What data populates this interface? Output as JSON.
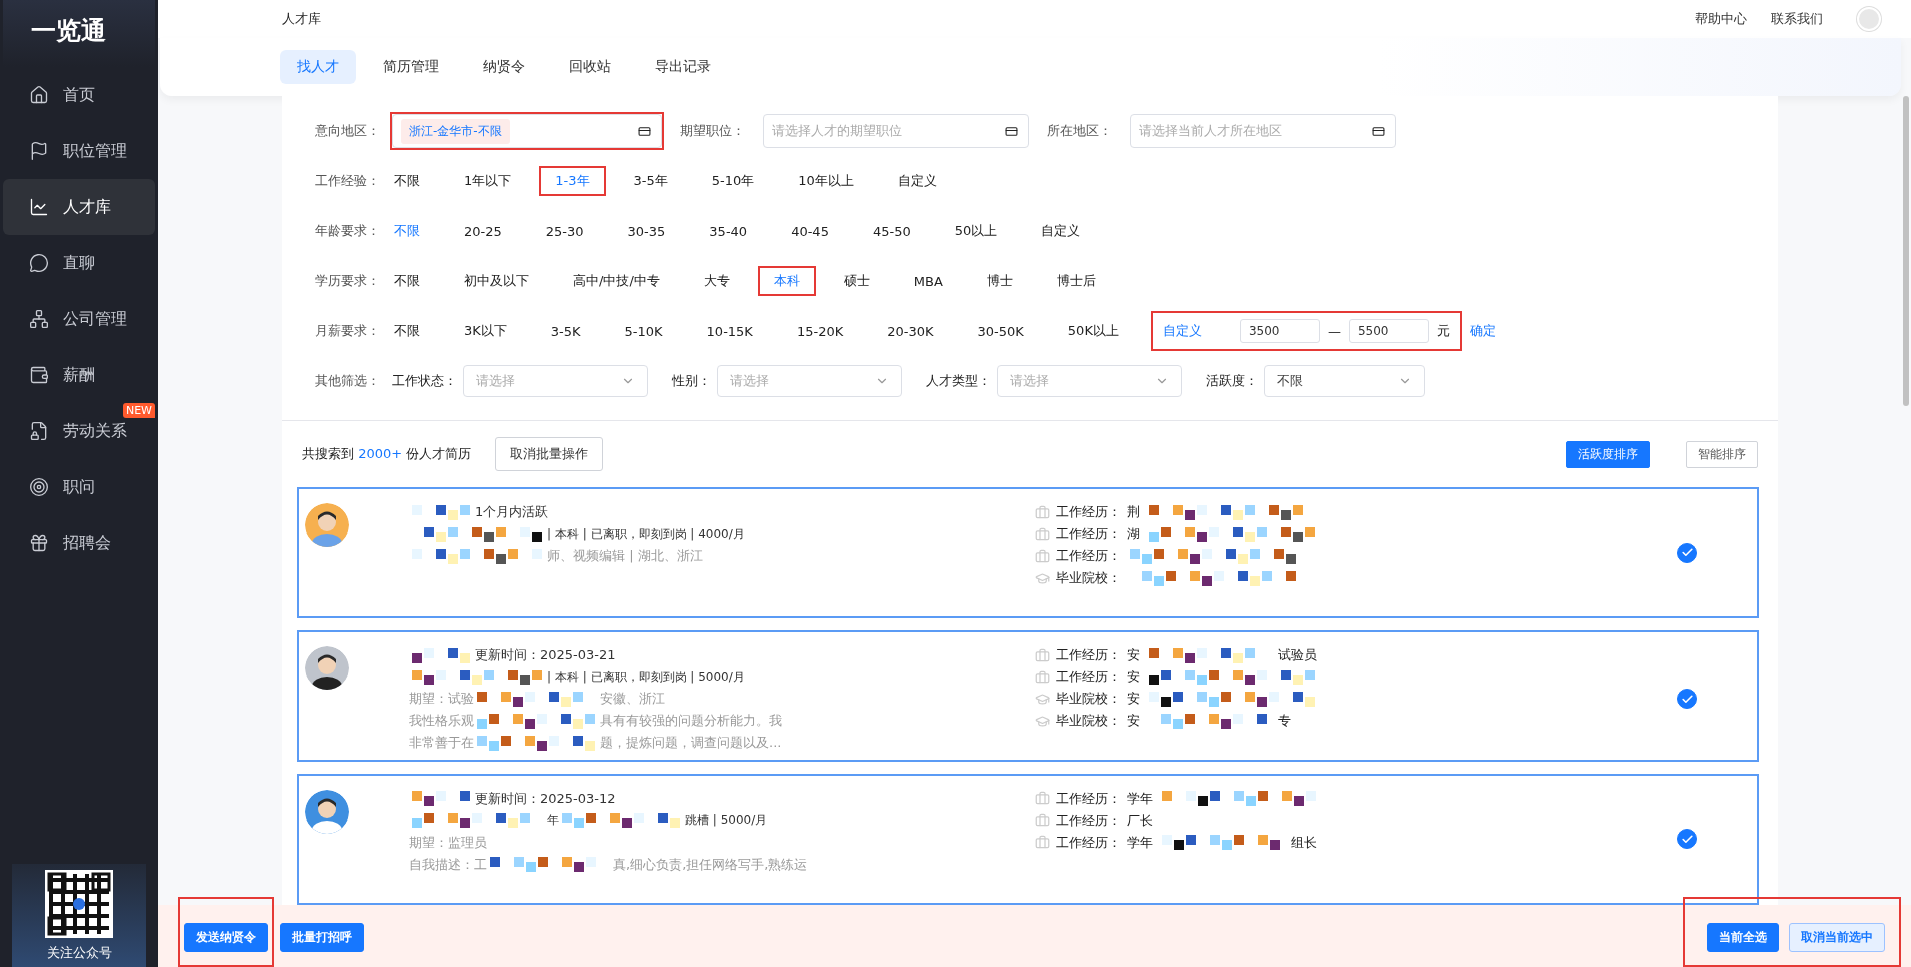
{
  "sidebar": {
    "logo": "一览通",
    "items": [
      {
        "label": "首页",
        "selected": false
      },
      {
        "label": "职位管理",
        "selected": false
      },
      {
        "label": "人才库",
        "selected": true
      },
      {
        "label": "直聊",
        "selected": false
      },
      {
        "label": "公司管理",
        "selected": false
      },
      {
        "label": "薪酬",
        "selected": false
      },
      {
        "label": "劳动关系",
        "selected": false,
        "badge": "NEW"
      },
      {
        "label": "职问",
        "selected": false
      },
      {
        "label": "招聘会",
        "selected": false
      }
    ],
    "qr_caption": "关注公众号"
  },
  "header": {
    "title": "人才库",
    "links": [
      "帮助中心",
      "联系我们"
    ]
  },
  "tabs": [
    {
      "label": "找人才",
      "selected": true
    },
    {
      "label": "简历管理",
      "selected": false
    },
    {
      "label": "纳贤令",
      "selected": false
    },
    {
      "label": "回收站",
      "selected": false
    },
    {
      "label": "导出记录",
      "selected": false
    }
  ],
  "filters": {
    "fields": [
      {
        "label": "意向地区：",
        "tag": "浙江-金华市-不限",
        "highlighted": true
      },
      {
        "label": "期望职位：",
        "placeholder": "请选择人才的期望职位",
        "highlighted": false
      },
      {
        "label": "所在地区：",
        "placeholder": "请选择当前人才所在地区",
        "highlighted": false
      }
    ],
    "rows": [
      {
        "label": "工作经验：",
        "options": [
          {
            "label": "不限",
            "selected": false,
            "highlighted": false
          },
          {
            "label": "1年以下",
            "selected": false,
            "highlighted": false
          },
          {
            "label": "1-3年",
            "selected": true,
            "highlighted": true
          },
          {
            "label": "3-5年",
            "selected": false,
            "highlighted": false
          },
          {
            "label": "5-10年",
            "selected": false,
            "highlighted": false
          },
          {
            "label": "10年以上",
            "selected": false,
            "highlighted": false
          },
          {
            "label": "自定义",
            "selected": false,
            "highlighted": false
          }
        ]
      },
      {
        "label": "年龄要求：",
        "options": [
          {
            "label": "不限",
            "selected": true,
            "highlighted": false
          },
          {
            "label": "20-25",
            "selected": false,
            "highlighted": false
          },
          {
            "label": "25-30",
            "selected": false,
            "highlighted": false
          },
          {
            "label": "30-35",
            "selected": false,
            "highlighted": false
          },
          {
            "label": "35-40",
            "selected": false,
            "highlighted": false
          },
          {
            "label": "40-45",
            "selected": false,
            "highlighted": false
          },
          {
            "label": "45-50",
            "selected": false,
            "highlighted": false
          },
          {
            "label": "50以上",
            "selected": false,
            "highlighted": false
          },
          {
            "label": "自定义",
            "selected": false,
            "highlighted": false
          }
        ]
      },
      {
        "label": "学历要求：",
        "options": [
          {
            "label": "不限",
            "selected": false,
            "highlighted": false
          },
          {
            "label": "初中及以下",
            "selected": false,
            "highlighted": false
          },
          {
            "label": "高中/中技/中专",
            "selected": false,
            "highlighted": false
          },
          {
            "label": "大专",
            "selected": false,
            "highlighted": false
          },
          {
            "label": "本科",
            "selected": true,
            "highlighted": true
          },
          {
            "label": "硕士",
            "selected": false,
            "highlighted": false
          },
          {
            "label": "MBA",
            "selected": false,
            "highlighted": false
          },
          {
            "label": "博士",
            "selected": false,
            "highlighted": false
          },
          {
            "label": "博士后",
            "selected": false,
            "highlighted": false
          }
        ]
      },
      {
        "label": "月薪要求：",
        "options": [
          {
            "label": "不限",
            "selected": false,
            "highlighted": false
          },
          {
            "label": "3K以下",
            "selected": false,
            "highlighted": false
          },
          {
            "label": "3-5K",
            "selected": false,
            "highlighted": false
          },
          {
            "label": "5-10K",
            "selected": false,
            "highlighted": false
          },
          {
            "label": "10-15K",
            "selected": false,
            "highlighted": false
          },
          {
            "label": "15-20K",
            "selected": false,
            "highlighted": false
          },
          {
            "label": "20-30K",
            "selected": false,
            "highlighted": false
          },
          {
            "label": "30-50K",
            "selected": false,
            "highlighted": false
          },
          {
            "label": "50K以上",
            "selected": false,
            "highlighted": false
          }
        ],
        "custom": {
          "label": "自定义",
          "selected": true,
          "highlighted": true,
          "min": "3500",
          "dash": "—",
          "max": "5500",
          "unit": "元",
          "confirm": "确定"
        }
      }
    ],
    "other": {
      "label": "其他筛选：",
      "selects": [
        {
          "label": "工作状态：",
          "placeholder": "请选择"
        },
        {
          "label": "性别：",
          "placeholder": "请选择"
        },
        {
          "label": "人才类型：",
          "placeholder": "请选择"
        },
        {
          "label": "活跃度：",
          "value": "不限"
        }
      ]
    }
  },
  "results": {
    "prefix": "共搜索到",
    "count": "2000+",
    "suffix": "份人才简历",
    "batch_button": "取消批量操作",
    "sorts": [
      {
        "label": "活跃度排序",
        "selected": true
      },
      {
        "label": "智能排序",
        "selected": false
      }
    ],
    "cards": [
      {
        "selected": true,
        "status": "1个月内活跃",
        "lines": [
          {
            "kind": "meta",
            "masked_start": true,
            "segments": [
              "| 本科 | 已离职，即刻到岗 | 4000/月"
            ]
          },
          {
            "kind": "muted",
            "masked_start": true,
            "segments": [
              "师、视频编辑 | 湖北、浙江"
            ]
          }
        ],
        "details": [
          {
            "kind": "work",
            "label": "工作经历：",
            "segments": [
              "荆"
            ],
            "masked_end": true
          },
          {
            "kind": "work",
            "label": "工作经历：",
            "segments": [
              "湖"
            ],
            "masked_end": true
          },
          {
            "kind": "work",
            "label": "工作经历：",
            "masked_end": true
          },
          {
            "kind": "school",
            "label": "毕业院校：",
            "masked_end": true
          }
        ]
      },
      {
        "selected": true,
        "status": "更新时间：2025-03-21",
        "lines": [
          {
            "kind": "meta",
            "masked_start": true,
            "segments": [
              "| 本科 | 已离职，即刻到岗 | 5000/月"
            ]
          },
          {
            "kind": "muted",
            "masked_start": false,
            "segments": [
              "期望：试验",
              "安徽、浙江"
            ]
          },
          {
            "kind": "muted",
            "masked_start": false,
            "segments": [
              "我性格乐观",
              "具有有较强的问题分析能力。我"
            ]
          },
          {
            "kind": "muted",
            "masked_start": false,
            "segments": [
              "非常善于在",
              "题，提炼问题，调查问题以及..."
            ]
          }
        ],
        "details": [
          {
            "kind": "work",
            "label": "工作经历：",
            "segments": [
              "安",
              "试验员"
            ],
            "masked_end": false
          },
          {
            "kind": "work",
            "label": "工作经历：",
            "segments": [
              "安"
            ],
            "masked_end": true
          },
          {
            "kind": "school",
            "label": "毕业院校：",
            "segments": [
              "安"
            ],
            "masked_end": true
          },
          {
            "kind": "school",
            "label": "毕业院校：",
            "segments": [
              "安",
              "专"
            ],
            "masked_end": false
          }
        ]
      },
      {
        "selected": true,
        "status": "更新时间：2025-03-12",
        "lines": [
          {
            "kind": "meta",
            "masked_start": true,
            "segments": [
              "年",
              "跳槽 | 5000/月"
            ]
          },
          {
            "kind": "muted",
            "masked_start": false,
            "segments": [
              "期望：监理员"
            ]
          },
          {
            "kind": "muted",
            "masked_start": false,
            "segments": [
              "自我描述：工",
              "真,细心负责,担任网络写手,熟练运"
            ]
          }
        ],
        "details": [
          {
            "kind": "work",
            "label": "工作经历：",
            "segments": [
              "学年"
            ],
            "masked_end": true
          },
          {
            "kind": "work",
            "label": "工作经历：",
            "segments": [
              "厂长"
            ],
            "masked_end": false
          },
          {
            "kind": "work",
            "label": "工作经历：",
            "segments": [
              "学年",
              "组长"
            ],
            "masked_end": false
          }
        ]
      }
    ]
  },
  "footer": {
    "left_buttons": [
      {
        "label": "发送纳贤令",
        "highlighted": true
      },
      {
        "label": "批量打招呼",
        "highlighted": false
      }
    ],
    "right_buttons": [
      {
        "label": "当前全选",
        "kind": "primary"
      },
      {
        "label": "取消当前选中",
        "kind": "secondary"
      }
    ],
    "right_highlighted": true
  }
}
